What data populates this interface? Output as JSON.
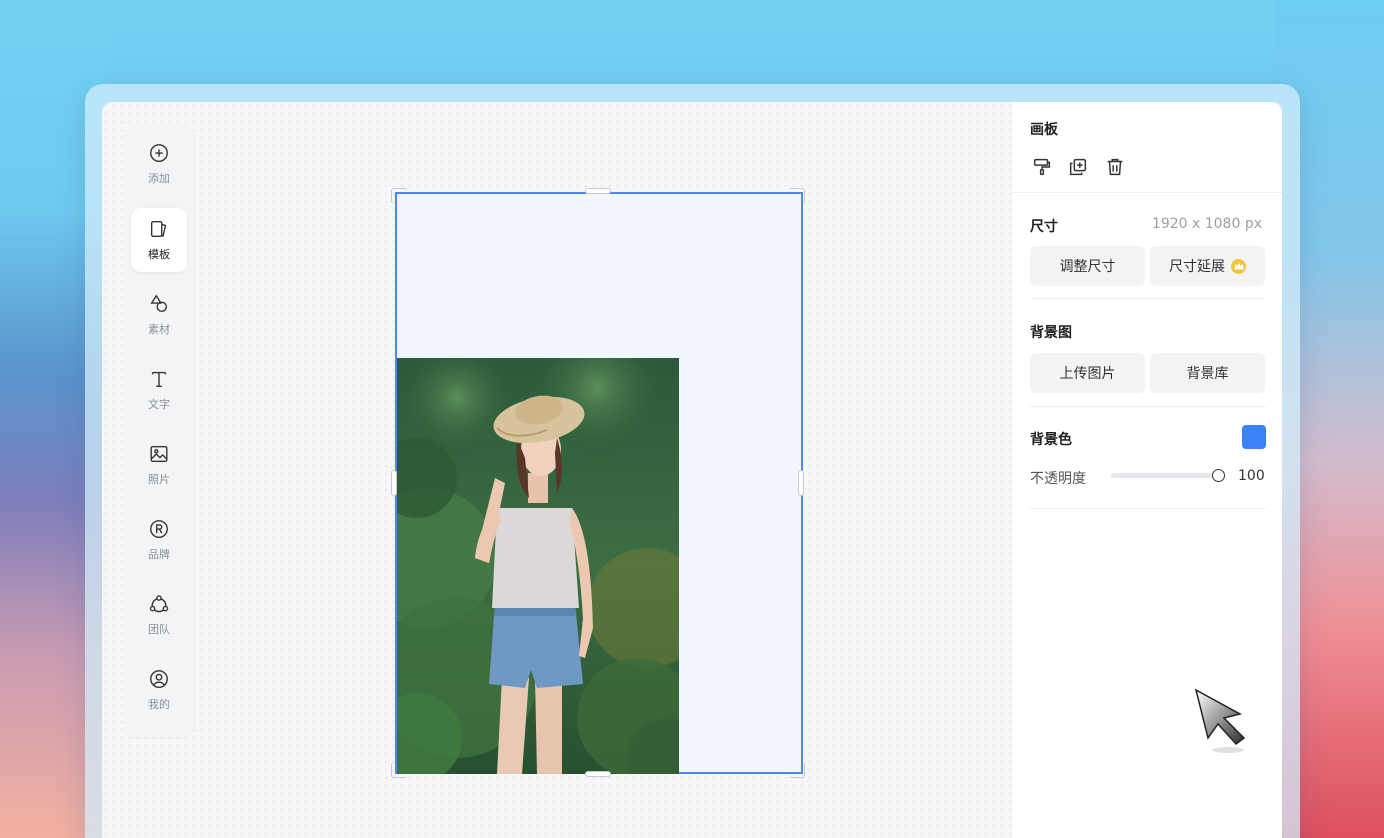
{
  "toolbar": {
    "items": [
      {
        "label": "添加",
        "icon": "plus-circle-icon",
        "active": false
      },
      {
        "label": "模板",
        "icon": "template-icon",
        "active": true
      },
      {
        "label": "素材",
        "icon": "shapes-icon",
        "active": false
      },
      {
        "label": "文字",
        "icon": "text-icon",
        "active": false
      },
      {
        "label": "照片",
        "icon": "image-icon",
        "active": false
      },
      {
        "label": "品牌",
        "icon": "registered-icon",
        "active": false
      },
      {
        "label": "团队",
        "icon": "team-icon",
        "active": false
      },
      {
        "label": "我的",
        "icon": "user-circle-icon",
        "active": false
      }
    ]
  },
  "canvas": {
    "photo": {
      "description_icon": "photo-woman-in-hat"
    }
  },
  "panel": {
    "title": "画板",
    "actions": [
      "format-painter-icon",
      "duplicate-icon",
      "trash-icon"
    ],
    "size": {
      "label": "尺寸",
      "value": "1920 x 1080 px",
      "resize_button": "调整尺寸",
      "extend_button": "尺寸延展"
    },
    "background_image": {
      "label": "背景图",
      "upload_button": "上传图片",
      "library_button": "背景库"
    },
    "background_color": {
      "label": "背景色",
      "color": "#3b82f6",
      "opacity_label": "不透明度",
      "opacity_value": "100",
      "opacity_fraction": 1.0
    }
  },
  "colors": {
    "accent": "#4f86ec",
    "swatch": "#3b82f6",
    "crown": "#f6c13c"
  }
}
